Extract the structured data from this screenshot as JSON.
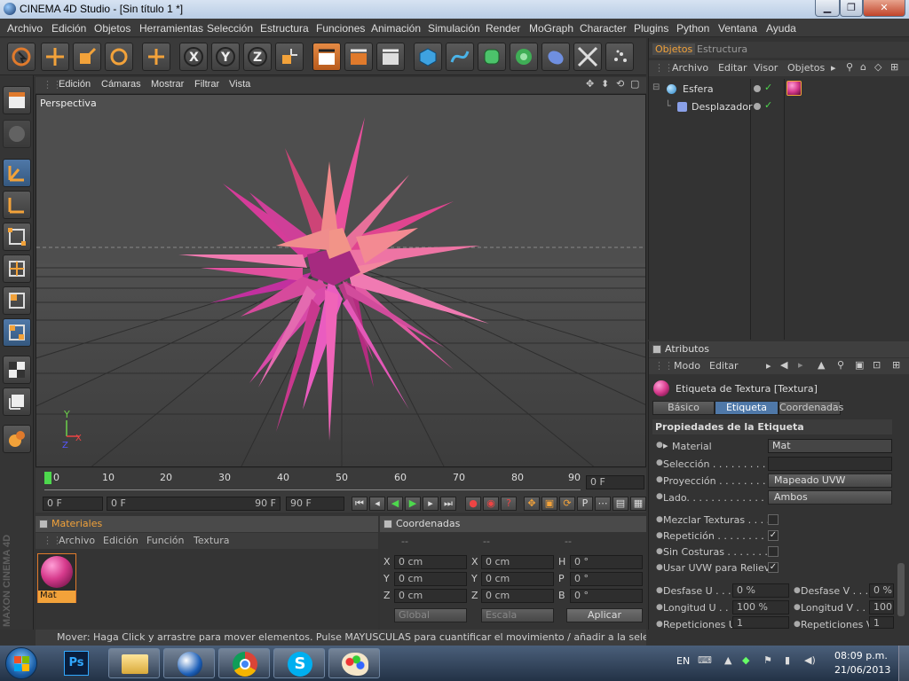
{
  "window": {
    "title": "CINEMA 4D Studio - [Sin título 1 *]"
  },
  "menu": [
    "Archivo",
    "Edición",
    "Objetos",
    "Herramientas",
    "Selección",
    "Estructura",
    "Funciones",
    "Animación",
    "Simulación",
    "Render",
    "MoGraph",
    "Character",
    "Plugins",
    "Python",
    "Ventana",
    "Ayuda"
  ],
  "viewport": {
    "menu": [
      "Edición",
      "Cámaras",
      "Mostrar",
      "Filtrar",
      "Vista"
    ],
    "label": "Perspectiva",
    "axis_x": "X",
    "axis_y": "Y",
    "axis_z": "Z"
  },
  "timeline": {
    "ticks": [
      "0",
      "10",
      "20",
      "30",
      "40",
      "50",
      "60",
      "70",
      "80",
      "90"
    ],
    "current_frame_right": "0 F",
    "start": "0 F",
    "range_start": "0 F",
    "range_end": "90 F",
    "end": "90 F"
  },
  "objects_panel": {
    "tabs": [
      "Objetos",
      "Estructura"
    ],
    "menu": [
      "Archivo",
      "Editar",
      "Visor",
      "Objetos"
    ],
    "items": [
      "Esfera",
      "Desplazador"
    ]
  },
  "attributes_panel": {
    "title": "Atributos",
    "menu": [
      "Modo",
      "Editar"
    ],
    "tag_title": "Etiqueta de Textura [Textura]",
    "tabs": [
      "Básico",
      "Etiqueta",
      "Coordenadas"
    ],
    "section": "Propiedades de la Etiqueta",
    "rows": [
      {
        "label": "Material",
        "value": "Mat"
      },
      {
        "label": "Selección . . . . . . . . . .",
        "value": ""
      },
      {
        "label": "Proyección . . . . . . . . .",
        "value": "Mapeado UVW"
      },
      {
        "label": "Lado. . . . . . . . . . . . .",
        "value": "Ambos"
      }
    ],
    "checks": [
      {
        "label": "Mezclar Texturas . . . . .",
        "mark": ""
      },
      {
        "label": "Repetición . . . . . . . . . .",
        "mark": "✓"
      },
      {
        "label": "Sin Costuras . . . . . . . .",
        "mark": ""
      },
      {
        "label": "Usar UVW para Relieve",
        "mark": "✓"
      }
    ],
    "pairs": [
      {
        "l1": "Desfase U . . .",
        "v1": "0 %",
        "l2": "Desfase V . . .",
        "v2": "0 %"
      },
      {
        "l1": "Longitud U . . .",
        "v1": "100 %",
        "l2": "Longitud V . . .",
        "v2": "100"
      },
      {
        "l1": "Repeticiones U",
        "v1": "1",
        "l2": "Repeticiones V",
        "v2": "1"
      }
    ]
  },
  "materials_panel": {
    "title": "Materiales",
    "menu": [
      "Archivo",
      "Edición",
      "Función",
      "Textura"
    ],
    "material_name": "Mat"
  },
  "coords_panel": {
    "title": "Coordenadas",
    "dashes": [
      "--",
      "--",
      "--"
    ],
    "rows": [
      {
        "a": "X",
        "av": "0 cm",
        "b": "X",
        "bv": "0 cm",
        "c": "H",
        "cv": "0 °"
      },
      {
        "a": "Y",
        "av": "0 cm",
        "b": "Y",
        "bv": "0 cm",
        "c": "P",
        "cv": "0 °"
      },
      {
        "a": "Z",
        "av": "0 cm",
        "b": "Z",
        "bv": "0 cm",
        "c": "B",
        "cv": "0 °"
      }
    ],
    "mode1": "Global",
    "mode2": "Escala",
    "apply": "Aplicar"
  },
  "status": "Mover: Haga Click y arrastre para mover elementos. Pulse MAYUSCULAS para cuantificar el movimiento / añadir a la selección en el modo p",
  "maxon": "MAXON CINEMA 4D",
  "taskbar": {
    "lang": "EN",
    "time": "08:09 p.m.",
    "date": "21/06/2013",
    "ps_label": "Ps"
  },
  "colors": {
    "accent": "#e07a2c",
    "selected": "#4f78a8",
    "material": "#d63a8c"
  }
}
